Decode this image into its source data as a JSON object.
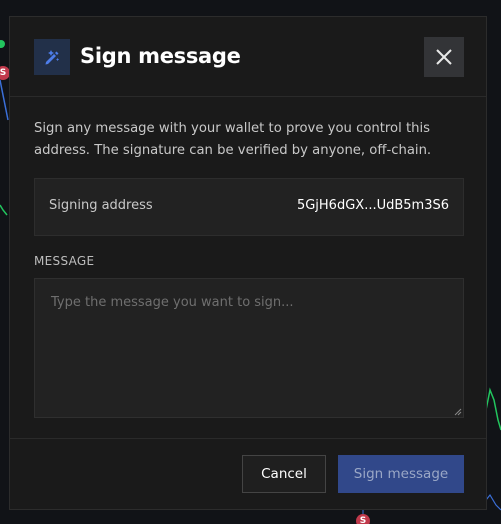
{
  "dialog": {
    "title": "Sign message",
    "description": "Sign any message with your wallet to prove you control this address. The signature can be verified by anyone, off-chain.",
    "signing_address": {
      "label": "Signing address",
      "value": "5GjH6dGX...UdB5m3S6"
    },
    "message": {
      "label": "MESSAGE",
      "placeholder": "Type the message you want to sign...",
      "value": ""
    },
    "buttons": {
      "cancel": "Cancel",
      "sign": "Sign message"
    },
    "icons": {
      "header": "pen-sign-icon",
      "close": "close-icon"
    }
  },
  "background": {
    "markers": [
      "S",
      "S"
    ]
  },
  "colors": {
    "modal_bg": "#1a1a1a",
    "accent": "#31488a",
    "icon_bg": "#223049",
    "marker_red": "#c0394b",
    "line_green": "#22c55e",
    "line_blue": "#3b6fd8"
  }
}
